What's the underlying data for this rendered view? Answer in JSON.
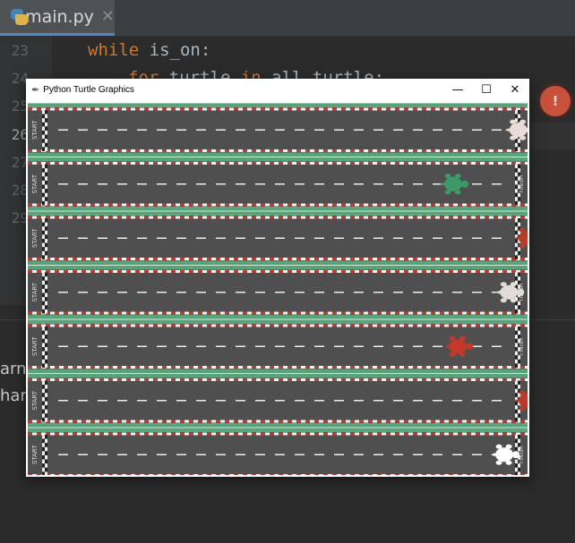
{
  "ide": {
    "tab_title": "main.py",
    "line_numbers": [
      "23",
      "24",
      "25",
      "26",
      "27",
      "28",
      "29"
    ],
    "current_line": "26",
    "code_line_23_kw": "while",
    "code_line_23_rest": " is_on:",
    "code_line_24_kw1": "for",
    "code_line_24_mid": " turtle ",
    "code_line_24_kw2": "in",
    "code_line_24_rest": " all_turtle:",
    "console_lines": [
      "arn",
      "han"
    ],
    "error_badge": "!"
  },
  "turtle_window": {
    "title": "Python Turtle Graphics",
    "minimize_label": "—",
    "maximize_label": "☐",
    "close_label": "✕",
    "start_label": "START",
    "finish_label": "FINISH",
    "lanes": [
      {
        "turtle_color": "#e7dcd6",
        "progress": 0.98
      },
      {
        "turtle_color": "#3d9a67",
        "progress": 0.84
      },
      {
        "turtle_color": "#b63b2a",
        "progress": 1.0
      },
      {
        "turtle_color": "#e1dcd8",
        "progress": 0.96
      },
      {
        "turtle_color": "#c0392b",
        "progress": 0.85
      },
      {
        "turtle_color": "#b63b2a",
        "progress": 1.0
      },
      {
        "turtle_color": "#ffffff",
        "progress": 0.95
      }
    ]
  },
  "colors": {
    "track": "#4f4f4f",
    "grass": "#5aa37a",
    "kerb_red": "#c13a2e",
    "kerb_white": "#f2f2f2",
    "lane_dash": "#ededed"
  }
}
